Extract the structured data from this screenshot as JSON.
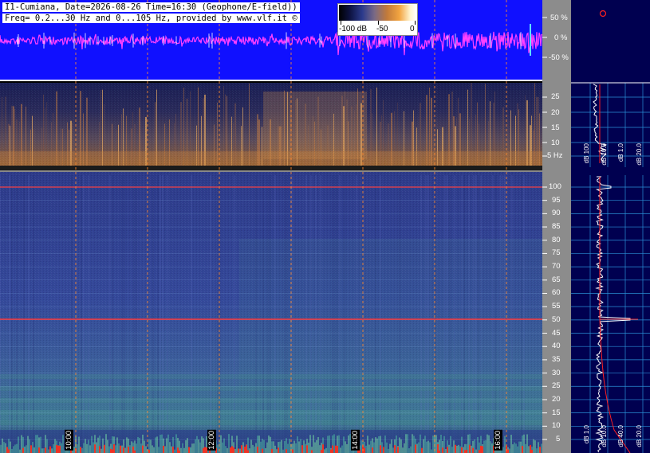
{
  "header": {
    "title_line": "I1-Cumiana, Date=2026-08-26 Time=16:30 (Geophone/E-field))",
    "freq_line": "Freq= 0.2...30 Hz and 0...105 Hz, provided by www.vlf.it ©"
  },
  "legend": {
    "labels": [
      "-100 dB",
      "-50",
      "0"
    ]
  },
  "waveform": {
    "labels": [
      "50 %",
      "0 %",
      "-50 %"
    ],
    "colors": {
      "background": "#1010ff",
      "trace": "#ff40ff"
    }
  },
  "low_band": {
    "freq_labels": [
      "25",
      "20",
      "15",
      "10",
      "5 Hz"
    ]
  },
  "high_band": {
    "freq_labels": [
      "100",
      "95",
      "90",
      "85",
      "80",
      "75",
      "70",
      "65",
      "60",
      "55",
      "50",
      "45",
      "40",
      "35",
      "30",
      "25",
      "20",
      "15",
      "10",
      "5"
    ]
  },
  "time_axis": {
    "labels": [
      "10:00",
      "12:00",
      "14:00",
      "16:00"
    ]
  },
  "spectrum_panel": {
    "upper_axis_labels": [
      "dB 100",
      "dB 10.0",
      "dB 1.0",
      "dB 20.0"
    ],
    "lower_axis_labels": [
      "dB 1.0",
      "dB 10.0",
      "dB 40.0",
      "dB 20.0"
    ],
    "colors": {
      "background": "#000050",
      "grid": "#2a8fd6",
      "trace": "#ffffff",
      "fit": "#ff2020"
    }
  },
  "colors": {
    "panel_gray": "#8c8c8c",
    "gridline_time": "#ff8a30",
    "line_50hz": "#ff3030"
  }
}
